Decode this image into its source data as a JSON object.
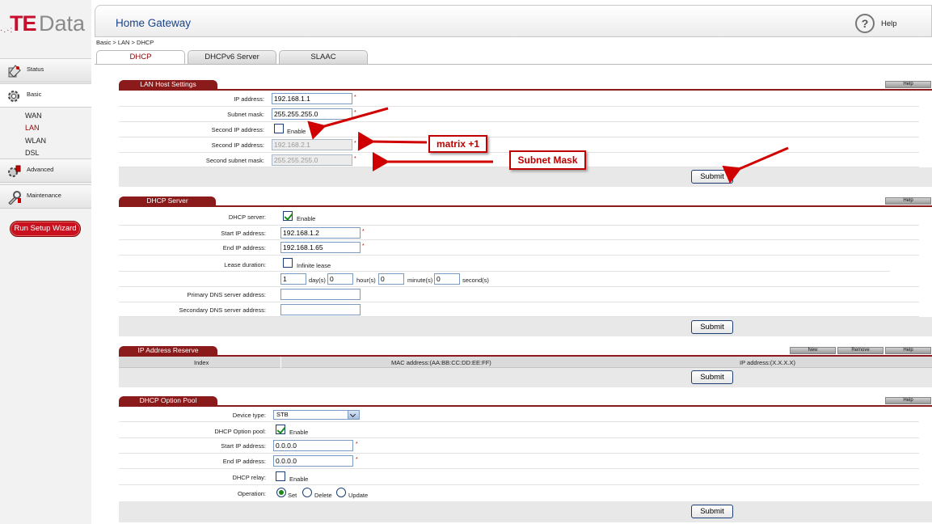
{
  "sidebar": {
    "logo_te": "TE",
    "logo_data": "Data",
    "nav": [
      {
        "label": "Status"
      },
      {
        "label": "Basic"
      },
      {
        "label": "Advanced"
      },
      {
        "label": "Maintenance"
      }
    ],
    "sub_items": [
      "WAN",
      "LAN",
      "WLAN",
      "DSL"
    ],
    "wizard_label": "Run Setup Wizard"
  },
  "header": {
    "title": "Home Gateway",
    "help_icon": "?",
    "help_label": "Help"
  },
  "breadcrumb": "Basic > LAN > DHCP",
  "tabs": [
    "DHCP",
    "DHCPv6 Server",
    "SLAAC"
  ],
  "lan_host": {
    "title": "LAN Host Settings",
    "help": "Help",
    "ip_label": "IP address:",
    "ip_value": "192.168.1.1",
    "mask_label": "Subnet mask:",
    "mask_value": "255.255.255.0",
    "second_ip_label": "Second IP address:",
    "enable": "Enable",
    "second_ip2_label": "Second IP address:",
    "second_ip_value": "192.168.2.1",
    "second_mask_label": "Second subnet mask:",
    "second_mask_value": "255.255.255.0",
    "submit": "Submit",
    "star": "*"
  },
  "dhcp_server": {
    "title": "DHCP Server",
    "help": "Help",
    "server_label": "DHCP server:",
    "enable": "Enable",
    "start_label": "Start IP address:",
    "start_value": "192.168.1.2",
    "end_label": "End IP address:",
    "end_value": "192.168.1.65",
    "lease_label": "Lease duration:",
    "infinite": "Infinite lease",
    "days_value": "1",
    "days_unit": "day(s)",
    "hours_value": "0",
    "hours_unit": "hour(s)",
    "minutes_value": "0",
    "minutes_unit": "minute(s)",
    "seconds_value": "0",
    "seconds_unit": "second(s)",
    "primary_dns_label": "Primary DNS server address:",
    "secondary_dns_label": "Secondary DNS server address:",
    "submit": "Submit"
  },
  "ip_reserve": {
    "title": "IP Address Reserve",
    "new": "New",
    "remove": "Remove",
    "help": "Help",
    "col_index": "Index",
    "col_mac": "MAC address:(AA:BB:CC:DD:EE:FF)",
    "col_ip": "IP address:(X.X.X.X)",
    "submit": "Submit"
  },
  "option_pool": {
    "title": "DHCP Option Pool",
    "help": "Help",
    "device_label": "Device type:",
    "device_value": "STB",
    "pool_label": "DHCP Option pool:",
    "enable": "Enable",
    "start_label": "Start IP address:",
    "start_value": "0.0.0.0",
    "end_label": "End IP address:",
    "end_value": "0.0.0.0",
    "relay_label": "DHCP relay:",
    "relay_enable": "Enable",
    "op_label": "Operation:",
    "op_set": "Set",
    "op_delete": "Delete",
    "op_update": "Update",
    "submit": "Submit"
  },
  "annotations": {
    "matrix": "matrix +1",
    "subnet": "Subnet Mask"
  },
  "colors": {
    "brand_red": "#c8102e",
    "section_red": "#8b1a1a",
    "link_blue": "#19438c"
  }
}
